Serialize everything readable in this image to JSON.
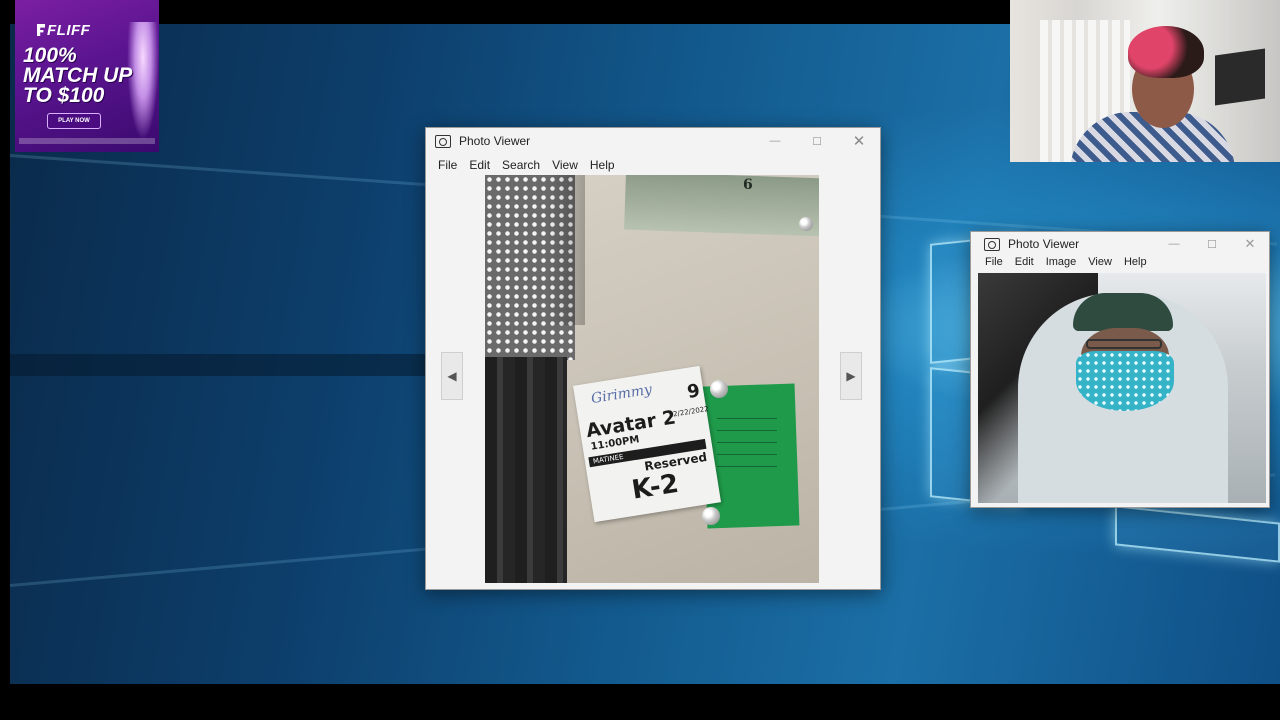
{
  "ad": {
    "brand": "FLIFF",
    "headline": "100% MATCH UP TO $100",
    "cta": "PLAY NOW"
  },
  "window_main": {
    "title": "Photo Viewer",
    "menu": [
      "File",
      "Edit",
      "Search",
      "View",
      "Help"
    ],
    "controls": [
      "minimize-icon",
      "maximize-icon",
      "close-icon"
    ],
    "photo_text": {
      "bill": "6",
      "handwriting": "Girimmy",
      "movie": "Avatar 2",
      "time": "11:00PM",
      "matinee": "MATINEE",
      "reserved": "Reserved",
      "seat": "K-2",
      "date": "12/22/2022",
      "ticket_num": "9"
    }
  },
  "window_second": {
    "title": "Photo Viewer",
    "menu": [
      "File",
      "Edit",
      "Image",
      "View",
      "Help"
    ],
    "controls": [
      "minimize-icon",
      "maximize-icon",
      "close-icon"
    ]
  },
  "colors": {
    "desktop_glow": "#8fdcff",
    "window_bg": "#f3f3f3",
    "ad_purple": "#6a1aa0"
  }
}
